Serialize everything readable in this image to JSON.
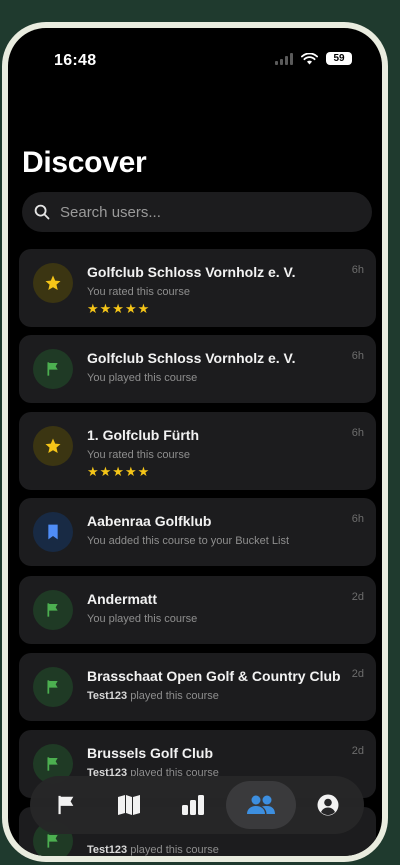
{
  "status_bar": {
    "time": "16:48",
    "battery": "59"
  },
  "page": {
    "title": "Discover"
  },
  "search": {
    "placeholder": "Search users..."
  },
  "feed": [
    {
      "name": "Golfclub Schloss Vornholz e. V.",
      "subtitle": "You rated this course",
      "time": "6h",
      "icon": "star-icon",
      "stars": "★★★★★",
      "rating": 5
    },
    {
      "name": "Golfclub Schloss Vornholz e. V.",
      "subtitle": "You played this course",
      "time": "6h",
      "icon": "flag-icon"
    },
    {
      "name": "1. Golfclub Fürth",
      "subtitle": "You rated this course",
      "time": "6h",
      "icon": "star-icon",
      "stars": "★★★★★",
      "rating": 5
    },
    {
      "name": "Aabenraa Golfklub",
      "subtitle": "You added this course to your Bucket List",
      "time": "6h",
      "icon": "bookmark-icon"
    },
    {
      "name": "Andermatt",
      "subtitle": "You played this course",
      "time": "2d",
      "icon": "flag-icon"
    },
    {
      "name": "Brasschaat Open Golf & Country Club",
      "user": "Test123",
      "subtitle": "played this course",
      "time": "2d",
      "icon": "flag-icon"
    },
    {
      "name": "Brussels Golf Club",
      "user": "Test123",
      "subtitle": "played this course",
      "time": "2d",
      "icon": "flag-icon"
    },
    {
      "user": "Test123",
      "subtitle": "played this course",
      "icon": "flag-icon"
    }
  ],
  "tab_bar": {
    "tabs": [
      "flag-icon",
      "map-icon",
      "stats-icon",
      "users-icon",
      "profile-icon"
    ],
    "active": "users-icon"
  },
  "colors": {
    "star": "#f5c518",
    "flag": "#4caf50",
    "bookmark": "#4f8df7",
    "active_tab": "#3d8fe0"
  }
}
